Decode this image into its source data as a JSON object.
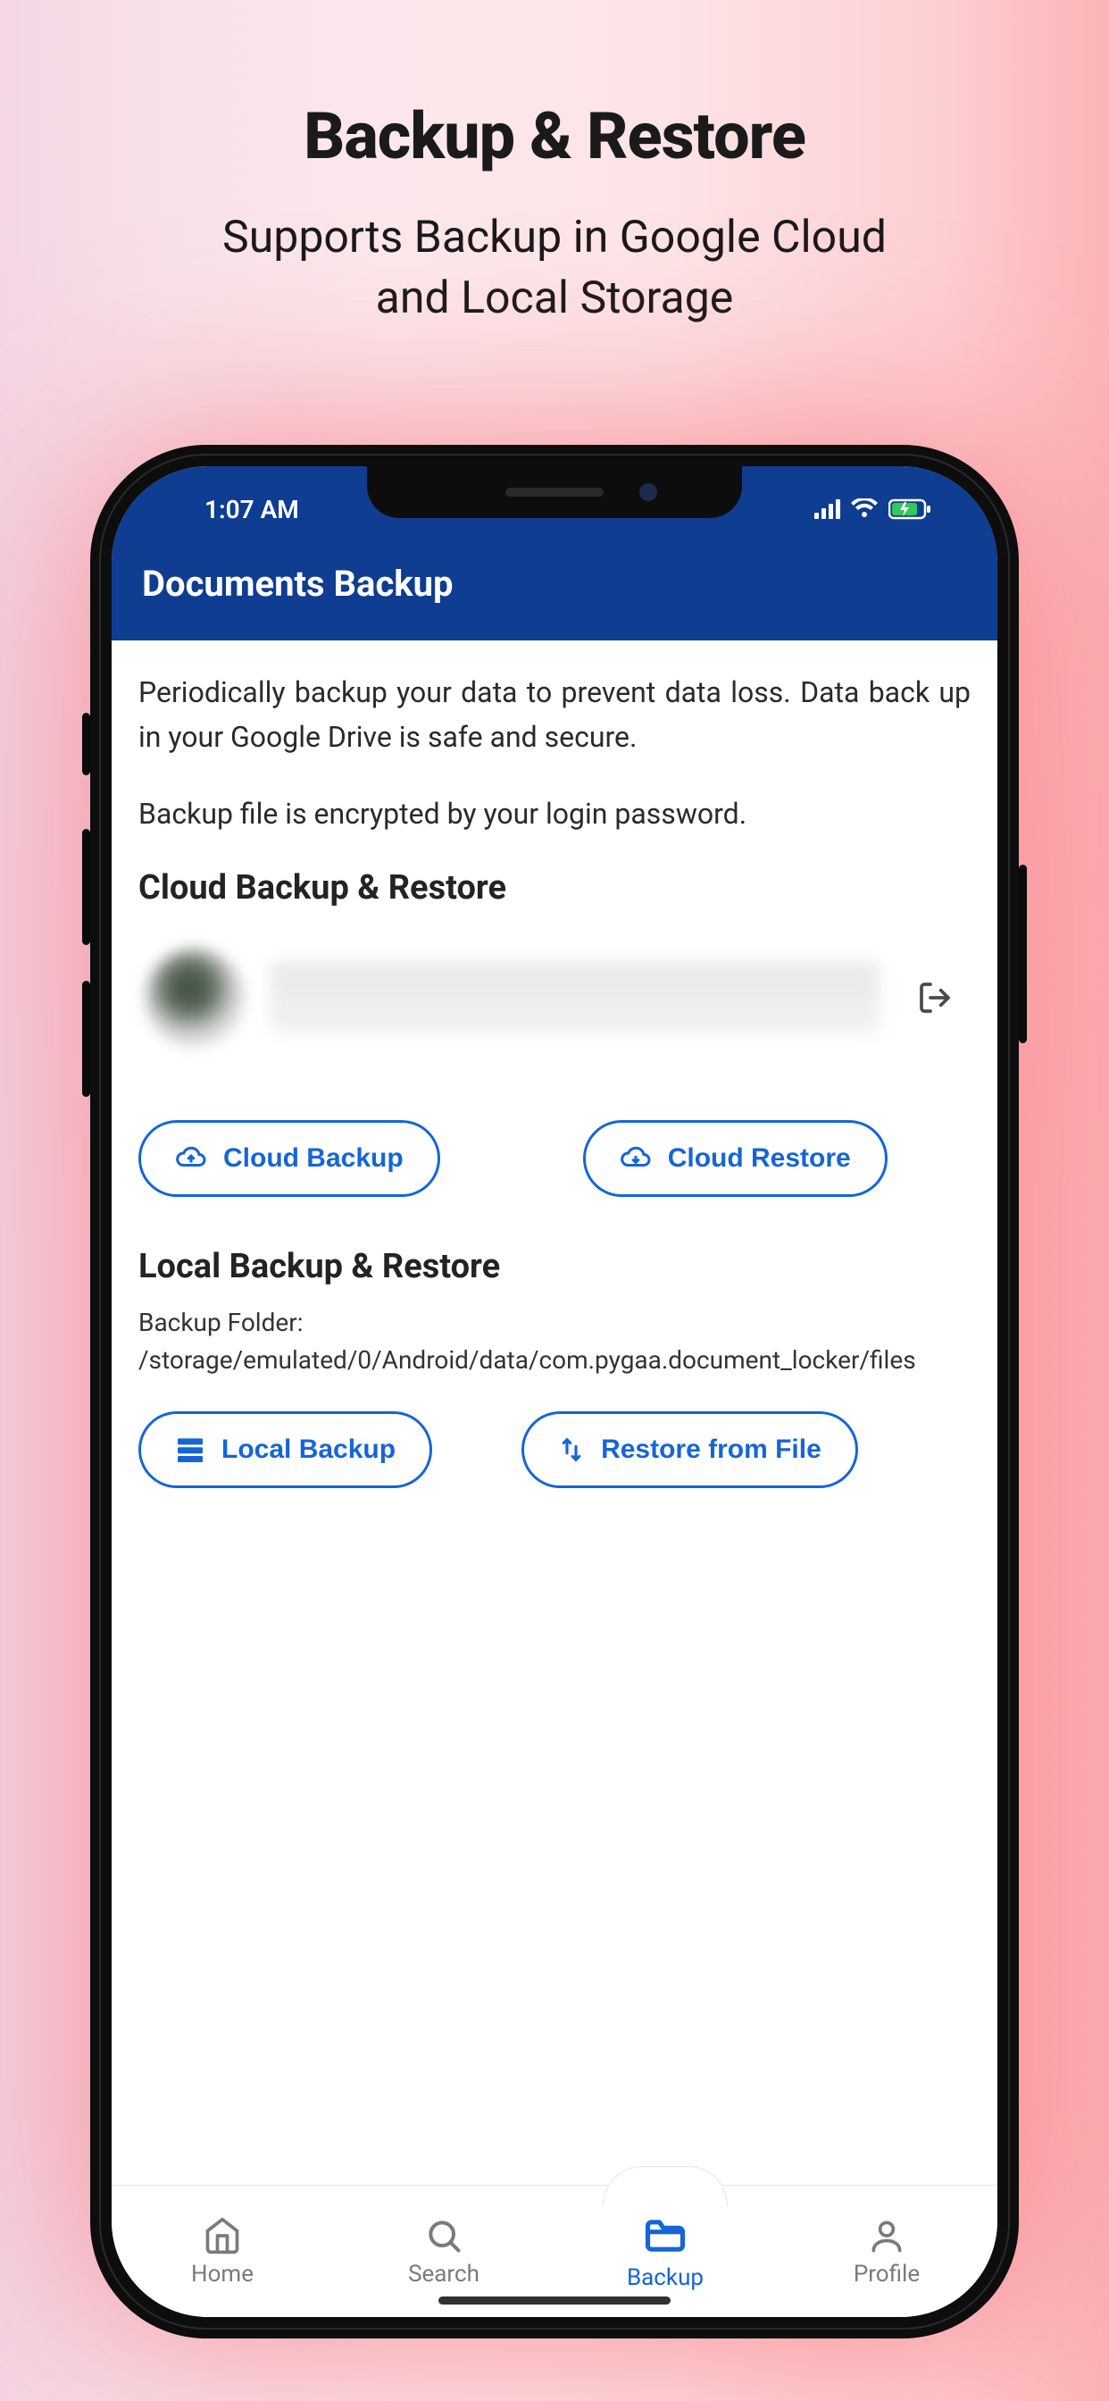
{
  "promo": {
    "title": "Backup & Restore",
    "subtitle_line1": "Supports Backup in Google Cloud",
    "subtitle_line2": "and Local Storage"
  },
  "status": {
    "time": "1:07 AM"
  },
  "appbar": {
    "title": "Documents Backup"
  },
  "content": {
    "description": "Periodically backup your data to prevent data loss. Data back up in your Google Drive is safe and secure.",
    "encryption_note": "Backup file is encrypted by your login password.",
    "cloud_section_title": "Cloud Backup & Restore",
    "local_section_title": "Local Backup & Restore",
    "backup_folder_label": "Backup Folder: ",
    "backup_folder_path": "/storage/emulated/0/Android/data/com.pygaa.document_locker/files"
  },
  "buttons": {
    "cloud_backup": "Cloud Backup",
    "cloud_restore": "Cloud Restore",
    "local_backup": "Local Backup",
    "restore_from_file": "Restore from File"
  },
  "nav": {
    "home": "Home",
    "search": "Search",
    "backup": "Backup",
    "profile": "Profile"
  }
}
